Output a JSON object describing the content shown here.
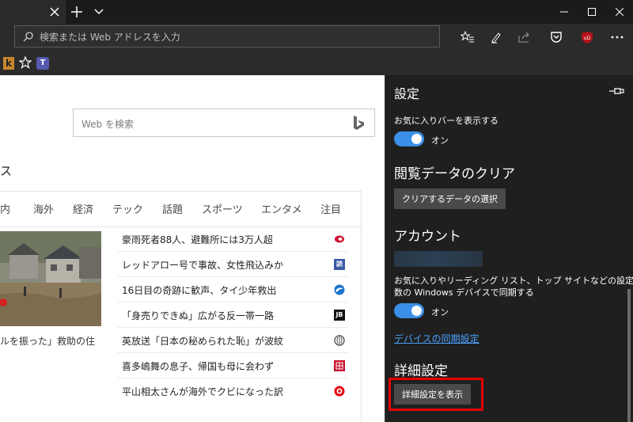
{
  "browser": {
    "address_placeholder": "検索または Web アドレスを入力"
  },
  "page": {
    "search_placeholder": "Web を検索",
    "fragment_heading": "ス",
    "nav": [
      "内",
      "海外",
      "経済",
      "テック",
      "話題",
      "スポーツ",
      "エンタメ",
      "注目"
    ],
    "caption": "ルを振った」救助の住",
    "news": [
      {
        "text": "豪雨死者88人、避難所には3万人超",
        "icon": "red-oval-icon",
        "color": "#d10f2f"
      },
      {
        "text": "レッドアロー号で事故、女性飛込みか",
        "icon": "yomiuri-icon",
        "color": "#3a5aa5",
        "mark": "読"
      },
      {
        "text": "16日目の奇跡に歓声、タイ少年救出",
        "icon": "swirl-logo-icon",
        "color": "#1f74c9"
      },
      {
        "text": "「身売りできぬ」広がる反一帯一路",
        "icon": "jb-logo-icon",
        "color": "#111111",
        "mark": "JB"
      },
      {
        "text": "英放送「日本の秘められた恥」が波紋",
        "icon": "globe-logo-icon",
        "color": "#555555"
      },
      {
        "text": "喜多嶋舞の息子、帰国も母に会わず",
        "icon": "red-square-logo-icon",
        "color": "#c8102e"
      },
      {
        "text": "平山相太さんが海外でクビになった訳",
        "icon": "red-circle-logo-icon",
        "color": "#e60012"
      }
    ]
  },
  "settings": {
    "title": "設定",
    "fav_bar_label": "お気に入りバーを表示する",
    "toggle_on": "オン",
    "clear_heading": "閲覧データのクリア",
    "clear_button": "クリアするデータの選択",
    "account_heading": "アカウント",
    "sync_desc_line1": "お気に入りやリーディング リスト、トップ サイトなどの設定を複",
    "sync_desc_line2": "数の Windows デバイスで同期する",
    "sync_link": "デバイスの同期設定",
    "advanced_heading": "詳細設定",
    "advanced_button": "詳細設定を表示",
    "accent_color": "#3b8fe6",
    "highlight_color": "#e60000"
  }
}
